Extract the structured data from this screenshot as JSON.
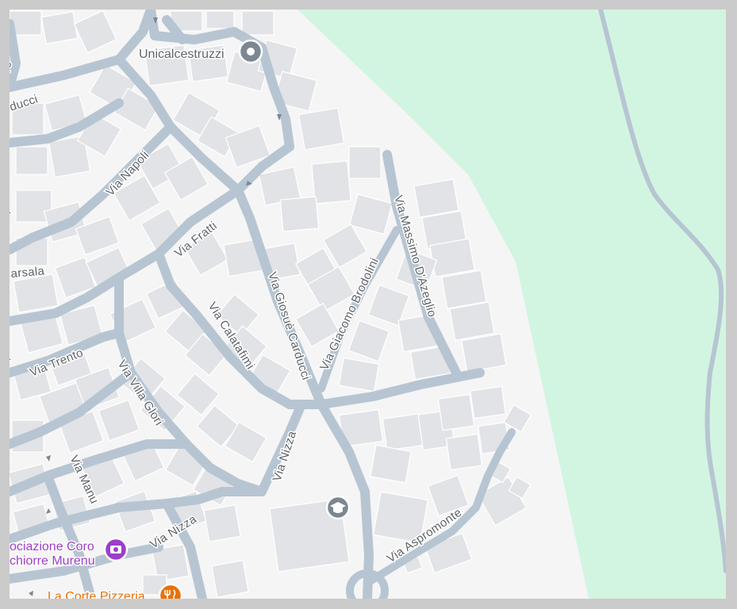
{
  "colors": {
    "background": "#f5f5f5",
    "park": "#d2f5e1",
    "road": "#b7c5d2",
    "building": "#e2e3e7",
    "building_edge": "#ffffff",
    "label": "#5f6368",
    "poi_purple": "#9c3ec8",
    "poi_orange": "#e8710a",
    "poi_gray": "#7c8793"
  },
  "streets": {
    "via_napoli": "Via Napoli",
    "via_fratti": "Via Fratti",
    "via_giosue_carducci": "Via Giosuè Carducci",
    "via_calatafimi": "Via Calatafimi",
    "via_giacomo_brodolini": "Via Giacomo Brodolini",
    "via_massimo_dazeglio": "Via Massimo D'Azeglio",
    "via_trento": "Via Trento",
    "via_villa_glori": "Via Villa Glori",
    "via_nizza_upper": "Via Nizza",
    "via_nizza_lower": "Via Nizza",
    "via_manu": "Via Manu",
    "via_aspromonte": "Via Aspromonte",
    "partial_carducci": "ducci",
    "partial_marsala": "arsala",
    "partial_top_left": "re",
    "partial_left_1": "i",
    "partial_left_2": "i"
  },
  "pois": {
    "unicalcestruzzi": {
      "label": "Unicalcestruzzi",
      "icon": "map-pin-icon"
    },
    "school": {
      "icon": "graduation-cap-icon"
    },
    "coro": {
      "line1": "ociazione Coro",
      "line2": "chiorre Murenu",
      "icon": "theater-icon"
    },
    "pizzeria": {
      "label": "La Corte Pizzeria",
      "icon": "restaurant-icon"
    }
  }
}
